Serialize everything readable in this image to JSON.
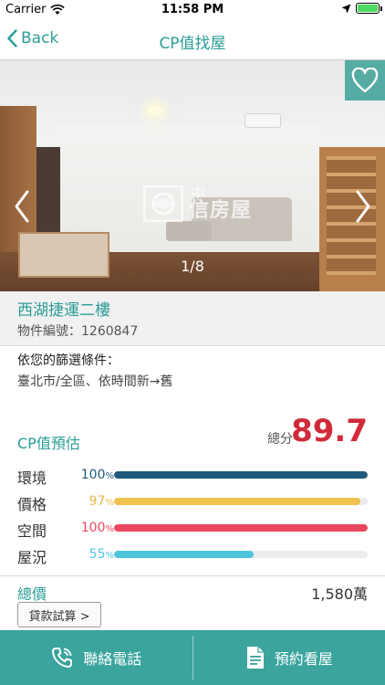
{
  "status_bar": {
    "carrier": "Carrier",
    "time": "11:58 PM"
  },
  "nav": {
    "back_label": "Back",
    "title": "CP值找屋"
  },
  "photo": {
    "counter": "1/8",
    "watermark_top": "中",
    "watermark_bottom": "信房屋"
  },
  "listing": {
    "title": "西湖捷運二樓",
    "id_label": "物件編號：1260847"
  },
  "filter": {
    "heading": "依您的篩選條件：",
    "text": "臺北市/全區、依時間新→舊"
  },
  "cp": {
    "label": "CP值預估",
    "score_label": "總分",
    "score": "89.7",
    "metrics": [
      {
        "name": "環境",
        "percent_number": "100",
        "percent_unit": "%",
        "value": 1.0,
        "color": "#1f5a7a",
        "pct_color": "#1f5a7a"
      },
      {
        "name": "價格",
        "percent_number": "97",
        "percent_unit": "%",
        "value": 0.97,
        "color": "#f0c24f",
        "pct_color": "#e8b84a"
      },
      {
        "name": "空間",
        "percent_number": "100",
        "percent_unit": "%",
        "value": 1.0,
        "color": "#e8475d",
        "pct_color": "#e8475d"
      },
      {
        "name": "屋況",
        "percent_number": "55",
        "percent_unit": "%",
        "value": 0.55,
        "color": "#4ec4e0",
        "pct_color": "#4ec4e0"
      }
    ]
  },
  "price": {
    "label": "總價",
    "value": "1,580萬",
    "loan_button": "貸款試算 >"
  },
  "bottom": {
    "call_label": "聯絡電話",
    "visit_label": "預約看屋"
  },
  "colors": {
    "accent": "#2a9c96",
    "score": "#d12a3a",
    "bottom_bar": "#3aa49d"
  }
}
